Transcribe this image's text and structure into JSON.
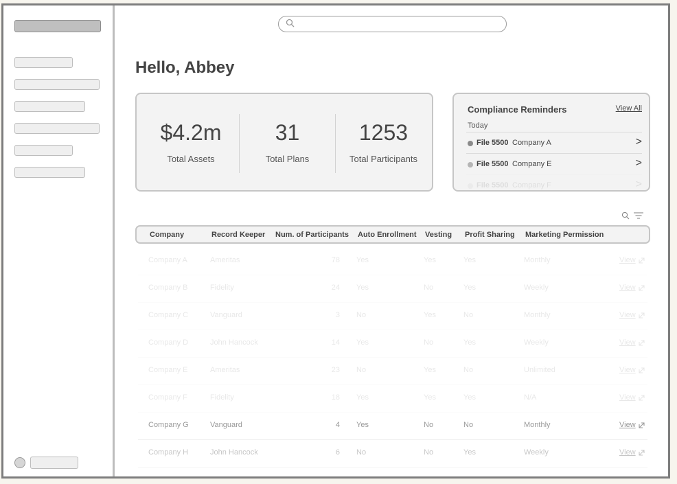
{
  "header": {
    "greeting": "Hello, Abbey"
  },
  "search": {
    "icon": "search-icon"
  },
  "stats": [
    {
      "value": "$4.2m",
      "label": "Total Assets"
    },
    {
      "value": "31",
      "label": "Total Plans"
    },
    {
      "value": "1253",
      "label": "Total Participants"
    }
  ],
  "reminders": {
    "title": "Compliance Reminders",
    "view_all": "View All",
    "group": "Today",
    "items": [
      {
        "task": "File 5500",
        "company": "Company A",
        "chevron": ">"
      },
      {
        "task": "File 5500",
        "company": "Company E",
        "chevron": ">"
      },
      {
        "task": "File 5500",
        "company": "Company F",
        "chevron": ">"
      }
    ]
  },
  "table": {
    "columns": [
      "Company",
      "Record Keeper",
      "Num. of Participants",
      "Auto Enrollment",
      "Vesting",
      "Profit Sharing",
      "Marketing Permission"
    ],
    "view_label": "View",
    "rows": [
      [
        "Company A",
        "Ameritas",
        "78",
        "Yes",
        "Yes",
        "Yes",
        "Monthly"
      ],
      [
        "Company B",
        "Fidelity",
        "24",
        "Yes",
        "No",
        "Yes",
        "Weekly"
      ],
      [
        "Company C",
        "Vanguard",
        "3",
        "No",
        "Yes",
        "No",
        "Monthly"
      ],
      [
        "Company D",
        "John Hancock",
        "14",
        "Yes",
        "No",
        "Yes",
        "Weekly"
      ],
      [
        "Company E",
        "Ameritas",
        "23",
        "No",
        "Yes",
        "No",
        "Unlimited"
      ],
      [
        "Company F",
        "Fidelity",
        "18",
        "Yes",
        "Yes",
        "Yes",
        "N/A"
      ],
      [
        "Company G",
        "Vanguard",
        "4",
        "Yes",
        "No",
        "No",
        "Monthly"
      ],
      [
        "Company H",
        "John Hancock",
        "6",
        "No",
        "No",
        "Yes",
        "Weekly"
      ]
    ]
  },
  "colors": {
    "frame": "#7d7d7d",
    "card_bg": "#f3f3f3",
    "card_border": "#c6c6c6",
    "text": "#444444"
  }
}
